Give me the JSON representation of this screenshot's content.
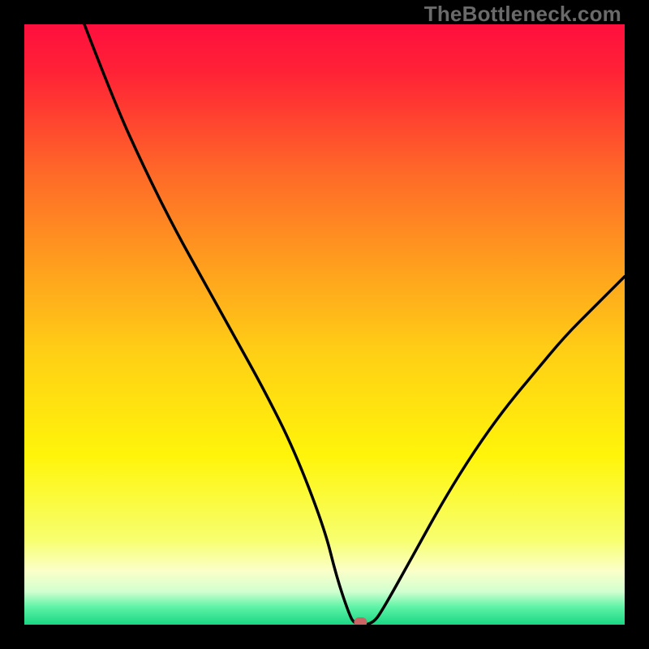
{
  "watermark": "TheBottleneck.com",
  "chart_data": {
    "type": "line",
    "title": "",
    "xlabel": "",
    "ylabel": "",
    "xlim": [
      0,
      100
    ],
    "ylim": [
      0,
      100
    ],
    "x": [
      10,
      15,
      20,
      25,
      30,
      35,
      40,
      45,
      50,
      52,
      54,
      55,
      58,
      60,
      65,
      70,
      75,
      80,
      85,
      90,
      95,
      100
    ],
    "values": [
      100,
      87,
      76,
      66,
      57,
      48,
      39,
      29,
      16,
      8,
      2,
      0,
      0,
      3,
      12,
      21,
      29,
      36,
      42,
      48,
      53,
      58
    ],
    "marker": {
      "x": 56,
      "y": 0,
      "color": "#cb6464"
    },
    "gradient_stops": [
      {
        "offset": 0.0,
        "color": "#ff0f3e"
      },
      {
        "offset": 0.08,
        "color": "#ff2236"
      },
      {
        "offset": 0.25,
        "color": "#ff6a28"
      },
      {
        "offset": 0.4,
        "color": "#ff9e1e"
      },
      {
        "offset": 0.55,
        "color": "#ffd015"
      },
      {
        "offset": 0.72,
        "color": "#fff50a"
      },
      {
        "offset": 0.86,
        "color": "#f7ff70"
      },
      {
        "offset": 0.91,
        "color": "#fbffc8"
      },
      {
        "offset": 0.945,
        "color": "#d1ffd0"
      },
      {
        "offset": 0.97,
        "color": "#60f3a7"
      },
      {
        "offset": 1.0,
        "color": "#18d783"
      }
    ]
  }
}
